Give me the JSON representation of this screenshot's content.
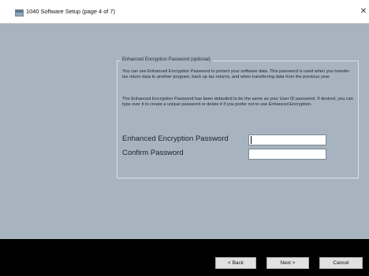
{
  "window": {
    "title": "1040 Software Setup (page 4 of 7)",
    "close_glyph": "✕",
    "icon": "app-window-icon"
  },
  "group": {
    "legend": "Enhanced Encryption Password (optional)",
    "description_1": "You can use Enhanced Encryption Password to protect your software data. This password is used when you transfer tax return data to another program, back up tax returns, and when transferring data from the previous year.",
    "description_2": "The Enhanced Encryption Password has been defaulted to be the same as your User ID password. If desired, you can type over it to create a unique password or delete it if you prefer not to use Enhanced Encryption."
  },
  "fields": {
    "password": {
      "label": "Enhanced Encryption Password",
      "value": ""
    },
    "confirm": {
      "label": "Confirm Password",
      "value": ""
    }
  },
  "buttons": {
    "back": "< Back",
    "next": "Next >",
    "cancel": "Cancel"
  },
  "colors": {
    "background": "#a7b4c0",
    "footer": "#000000",
    "titlebar": "#ffffff"
  }
}
